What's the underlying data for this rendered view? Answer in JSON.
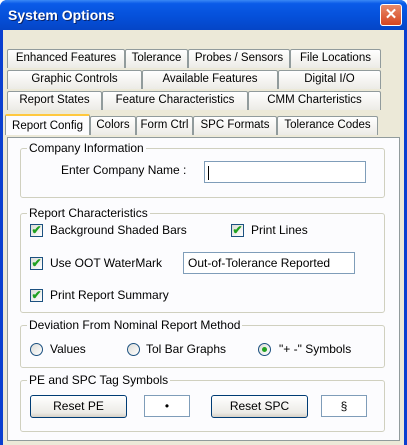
{
  "window": {
    "title": "System Options",
    "close_glyph": "✕"
  },
  "tabs": {
    "row1": [
      "Enhanced Features",
      "Tolerance",
      "Probes / Sensors",
      "File Locations"
    ],
    "row2": [
      "Graphic Controls",
      "Available Features",
      "Digital I/O"
    ],
    "row3": [
      "Report States",
      "Feature Characteristics",
      "CMM Charteristics"
    ],
    "row4": [
      "Report Config",
      "Colors",
      "Form Ctrl",
      "SPC Formats",
      "Tolerance Codes"
    ],
    "active": "Report Config"
  },
  "company": {
    "group_title": "Company Information",
    "name_label": "Enter Company Name :",
    "name_value": ""
  },
  "report": {
    "group_title": "Report Characteristics",
    "background_shaded_bars": {
      "label": "Background Shaded Bars",
      "checked": true
    },
    "print_lines": {
      "label": "Print Lines",
      "checked": true
    },
    "use_oot_watermark": {
      "label": "Use OOT WaterMark",
      "checked": true
    },
    "watermark_text": "Out-of-Tolerance Reported",
    "print_report_summary": {
      "label": "Print Report Summary",
      "checked": true
    }
  },
  "deviation": {
    "group_title": "Deviation From Nominal Report Method",
    "options": [
      "Values",
      "Tol Bar Graphs",
      "\"+ -\" Symbols"
    ],
    "selected": "\"+ -\" Symbols"
  },
  "tags": {
    "group_title": "PE and SPC Tag Symbols",
    "reset_pe": "Reset PE",
    "pe_symbol": "•",
    "reset_spc": "Reset SPC",
    "spc_symbol": "§"
  },
  "colors": {
    "title_bar": "#0550DA",
    "close_button": "#D6451F",
    "dialog_bg": "#ECE9D8",
    "check_mark": "#21A121",
    "active_tab_highlight": "#FFC83C"
  }
}
